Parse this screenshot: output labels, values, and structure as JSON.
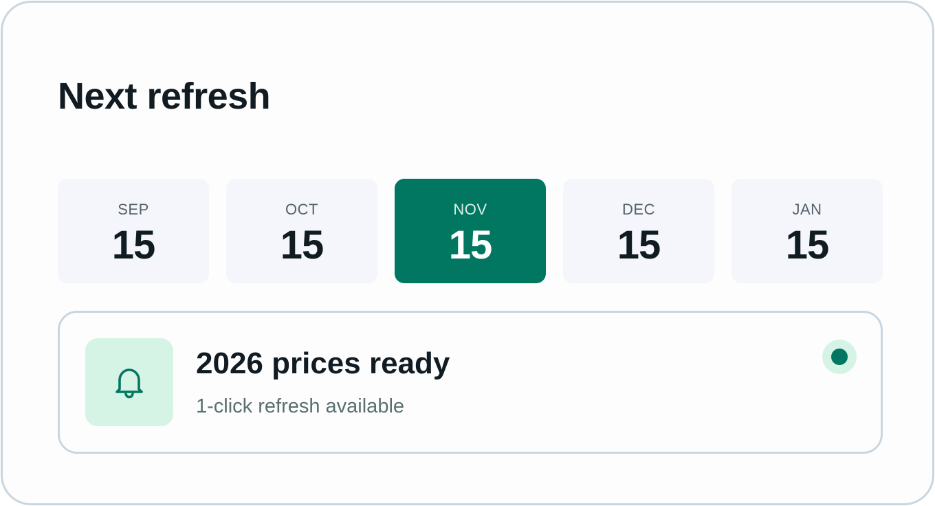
{
  "header": {
    "title": "Next refresh"
  },
  "dates": [
    {
      "month": "SEP",
      "day": "15",
      "selected": false
    },
    {
      "month": "OCT",
      "day": "15",
      "selected": false
    },
    {
      "month": "NOV",
      "day": "15",
      "selected": true
    },
    {
      "month": "DEC",
      "day": "15",
      "selected": false
    },
    {
      "month": "JAN",
      "day": "15",
      "selected": false
    }
  ],
  "notification": {
    "icon": "bell-icon",
    "title": "2026 prices ready",
    "subtitle": "1-click refresh available",
    "status": "active"
  },
  "colors": {
    "accent": "#017762",
    "accent_light": "#d6f4e5",
    "tile_background": "#f4f6fb",
    "border": "#c9d6df",
    "text_primary": "#111b22",
    "text_secondary": "#5a6f70"
  }
}
